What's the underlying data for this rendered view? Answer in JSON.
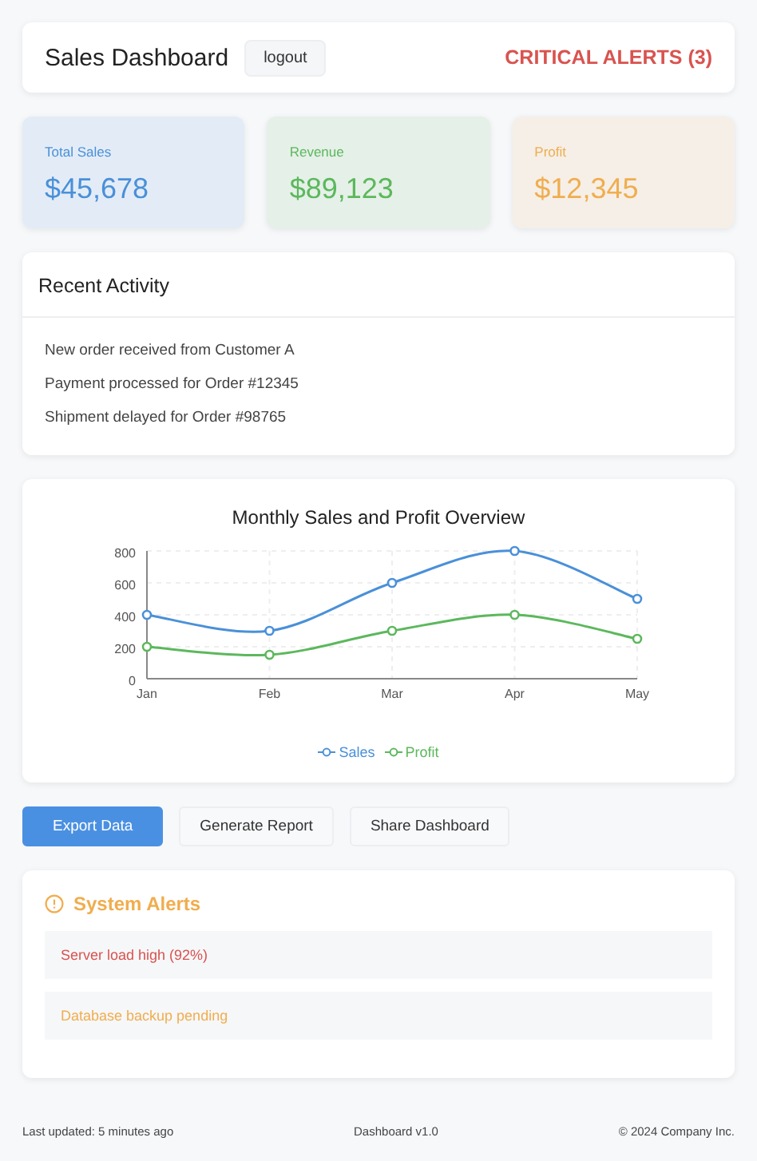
{
  "header": {
    "title": "Sales Dashboard",
    "logout_button": "logout",
    "alerts_link": "CRITICAL ALERTS (3)"
  },
  "stats": [
    {
      "label": "Total Sales",
      "value": "$45,678",
      "color": "#4a90d9"
    },
    {
      "label": "Revenue",
      "value": "$89,123",
      "color": "#5cb85c"
    },
    {
      "label": "Profit",
      "value": "$12,345",
      "color": "#f0ad4e"
    }
  ],
  "recent_activity": {
    "title": "Recent Activity",
    "items": [
      "New order received from Customer A",
      "Payment processed for Order #12345",
      "Shipment delayed for Order #98765"
    ]
  },
  "chart": {
    "chart_data": {
      "type": "line",
      "title": "Monthly Sales and Profit Overview",
      "categories": [
        "Jan",
        "Feb",
        "Mar",
        "Apr",
        "May"
      ],
      "ylim": [
        0,
        800
      ],
      "grid": true,
      "yticks": [
        0,
        200,
        400,
        600,
        800
      ],
      "series": [
        {
          "name": "Sales",
          "color": "#4a90d9",
          "marker": "circle",
          "values": [
            400,
            300,
            600,
            800,
            500
          ]
        },
        {
          "name": "Profit",
          "color": "#5cb85c",
          "marker": "circle",
          "values": [
            200,
            150,
            300,
            400,
            250
          ]
        }
      ]
    }
  },
  "actions": [
    {
      "label": "Export Data",
      "kind": "primary"
    },
    {
      "label": "Generate Report",
      "kind": "secondary"
    },
    {
      "label": "Share Dashboard",
      "kind": "secondary"
    }
  ],
  "system_alerts": {
    "title": "System Alerts",
    "items": [
      {
        "text": "Server load high (92%)",
        "color": "#d9534f"
      },
      {
        "text": "Database backup pending",
        "color": "#f0ad4e"
      }
    ]
  },
  "footer": {
    "updated": "Last updated: 5 minutes ago",
    "version": "Dashboard v1.0",
    "copyright": "© 2024 Company Inc."
  }
}
